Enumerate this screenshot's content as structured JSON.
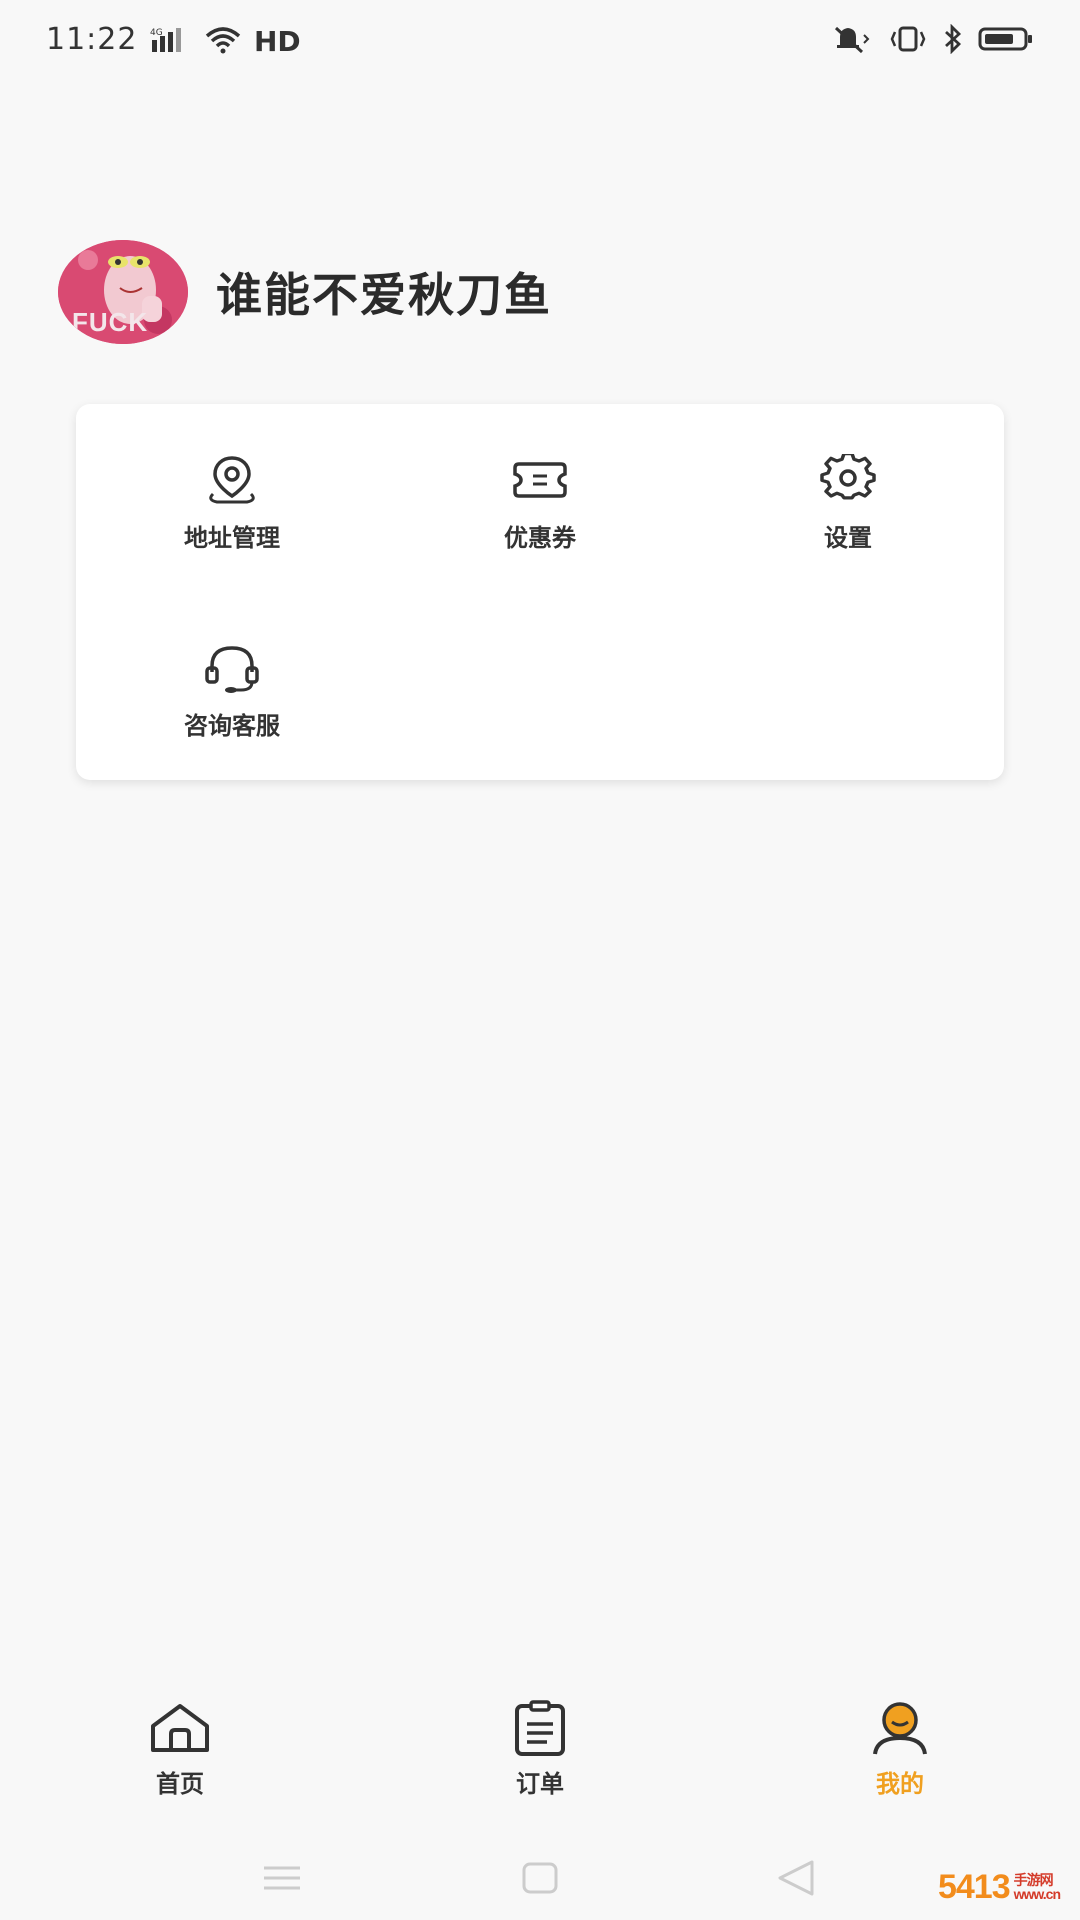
{
  "status_bar": {
    "time": "11:22",
    "network": "4G",
    "hd": "HD",
    "icons": [
      "signal-icon",
      "wifi-icon",
      "mute-icon",
      "vibrate-icon",
      "bluetooth-icon",
      "battery-icon"
    ]
  },
  "profile": {
    "avatar_text": "FUCK",
    "username": "谁能不爱秋刀鱼"
  },
  "menu": {
    "items": [
      {
        "label": "地址管理",
        "icon": "location-pin-icon"
      },
      {
        "label": "优惠券",
        "icon": "coupon-ticket-icon"
      },
      {
        "label": "设置",
        "icon": "gear-icon"
      },
      {
        "label": "咨询客服",
        "icon": "headset-icon"
      }
    ]
  },
  "bottom_nav": {
    "items": [
      {
        "label": "首页",
        "icon": "home-icon",
        "active": false
      },
      {
        "label": "订单",
        "icon": "clipboard-icon",
        "active": false
      },
      {
        "label": "我的",
        "icon": "user-icon",
        "active": true
      }
    ]
  },
  "system_nav": {
    "icons": [
      "menu-lines-icon",
      "home-square-icon",
      "back-triangle-icon"
    ]
  },
  "watermark": {
    "main": "5413",
    "sub": "手游网",
    "domain": "www.cn"
  },
  "colors": {
    "accent": "#f0a020",
    "background": "#f8f8f8",
    "card": "#ffffff",
    "text": "#333333"
  }
}
